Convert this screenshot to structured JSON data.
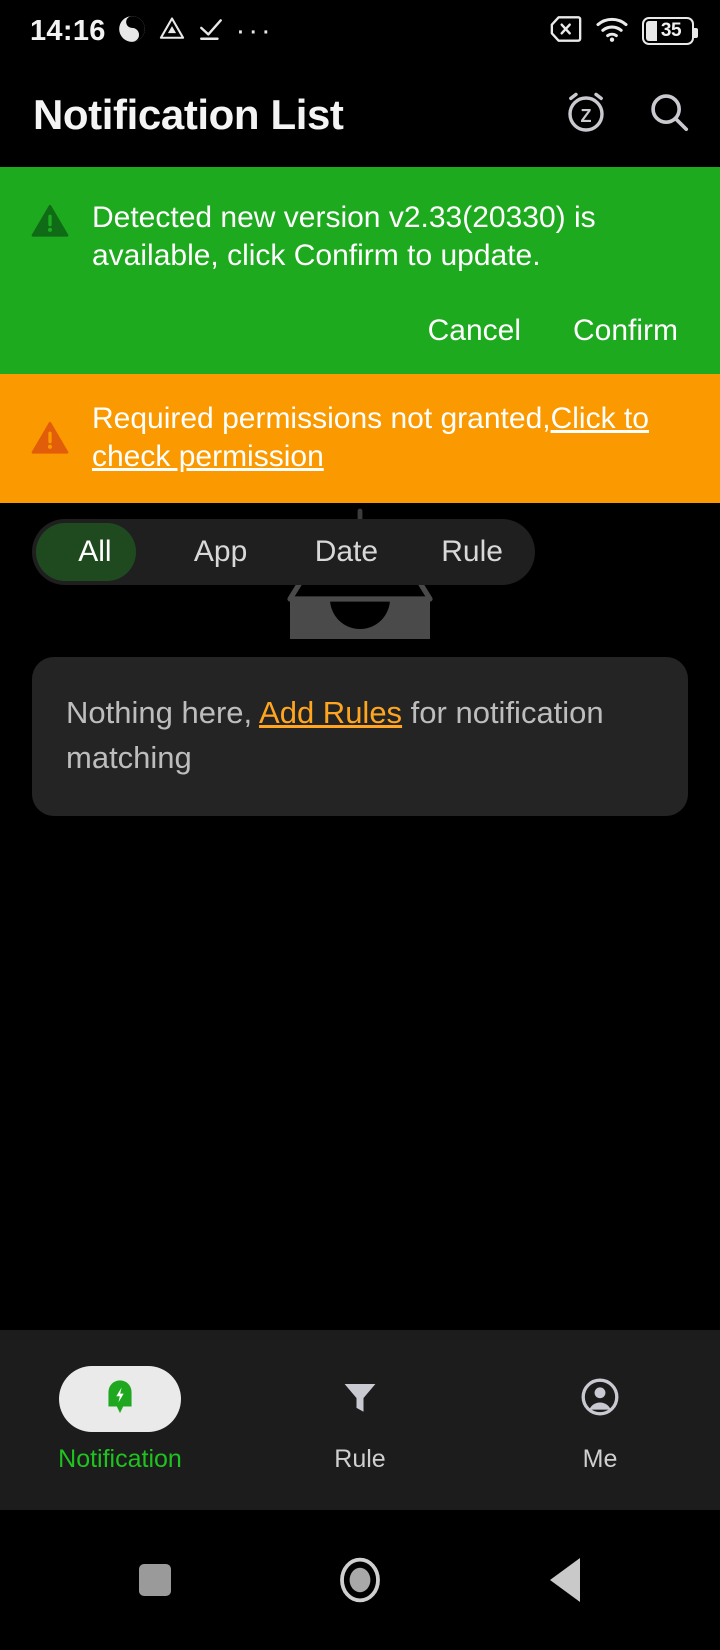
{
  "status_bar": {
    "time": "14:16",
    "left_icons": [
      "app-badge-icon",
      "triangle-app-icon",
      "download-check-icon"
    ],
    "overflow": "···",
    "sim_icon": "sim-card-disabled-icon",
    "wifi_icon": "wifi-icon",
    "battery_level": "35"
  },
  "header": {
    "title": "Notification List",
    "snooze_icon": "alarm-snooze-icon",
    "search_icon": "search-icon"
  },
  "update_banner": {
    "icon": "warning-triangle-icon",
    "message": "Detected new version v2.33(20330) is available, click Confirm to update.",
    "cancel_label": "Cancel",
    "confirm_label": "Confirm",
    "background": "#1eaa1e"
  },
  "permission_banner": {
    "icon": "warning-triangle-icon",
    "message": "Required permissions not granted,",
    "link_text": "Click to check permission",
    "background": "#fb9900"
  },
  "filter_tabs": {
    "items": [
      {
        "label": "All",
        "active": true
      },
      {
        "label": "App",
        "active": false
      },
      {
        "label": "Date",
        "active": false
      },
      {
        "label": "Rule",
        "active": false
      }
    ],
    "active_color": "#1f4a20"
  },
  "empty_state": {
    "illustration": "empty-inbox-tray-icon",
    "text_before": "Nothing here, ",
    "link_text": "Add Rules",
    "text_after": " for notification matching",
    "link_color": "#ffa51f"
  },
  "bottom_nav": {
    "items": [
      {
        "label": "Notification",
        "icon": "bell-lightning-icon",
        "active": true
      },
      {
        "label": "Rule",
        "icon": "filter-funnel-icon",
        "active": false
      },
      {
        "label": "Me",
        "icon": "account-circle-icon",
        "active": false
      }
    ],
    "active_color": "#1fc31f"
  },
  "system_nav": {
    "recents_icon": "square-recents-icon",
    "home_icon": "circle-home-icon",
    "back_icon": "triangle-back-icon"
  }
}
